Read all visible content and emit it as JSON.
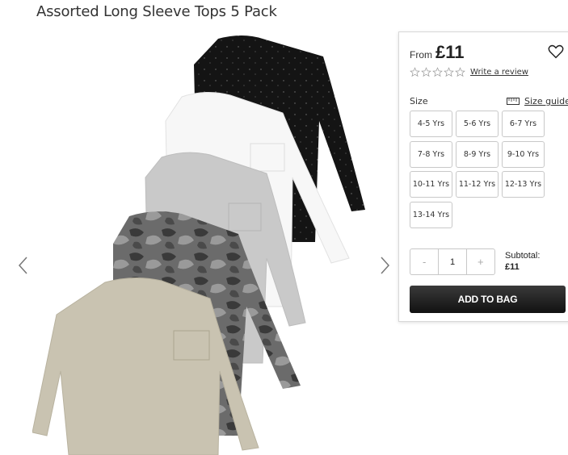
{
  "product": {
    "title": "Assorted Long Sleeve Tops 5 Pack",
    "image_icon": "tops-5-pack-image"
  },
  "gallery": {
    "prev_icon": "chevron-left-icon",
    "next_icon": "chevron-right-icon"
  },
  "panel": {
    "price_from": "From",
    "price": "£11",
    "wishlist_icon": "heart-icon",
    "rating": 0,
    "rating_max": 5,
    "review_link": "Write a review",
    "size_label": "Size",
    "size_guide_icon": "ruler-icon",
    "size_guide": "Size guide",
    "sizes": [
      "4-5 Yrs",
      "5-6 Yrs",
      "6-7 Yrs",
      "7-8 Yrs",
      "8-9 Yrs",
      "9-10 Yrs",
      "10-11 Yrs",
      "11-12 Yrs",
      "12-13 Yrs",
      "13-14 Yrs"
    ],
    "quantity": {
      "minus": "-",
      "value": "1",
      "plus": "+"
    },
    "subtotal_label": "Subtotal:",
    "subtotal_value": "£11",
    "add_to_bag": "ADD TO BAG"
  },
  "colors": {
    "button_dark": "#222222",
    "border": "#c8c8c8"
  }
}
